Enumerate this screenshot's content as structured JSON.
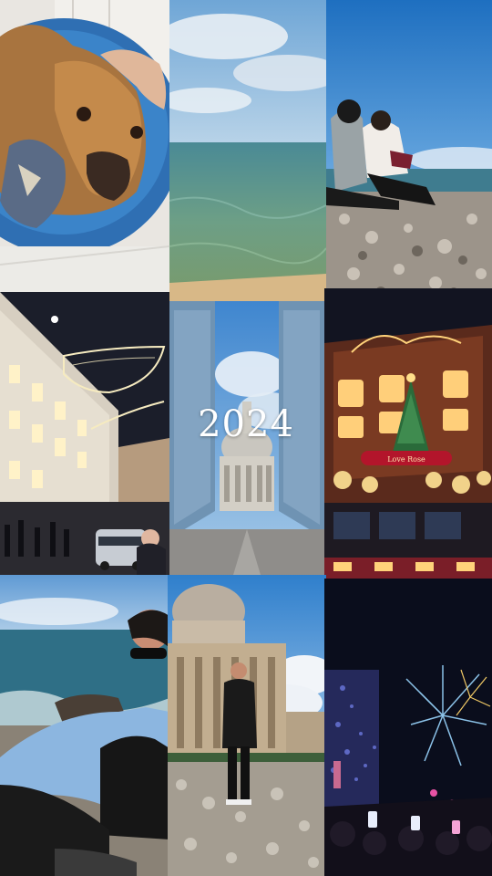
{
  "overlay": {
    "year_title": "2024"
  },
  "sign": {
    "store_text": "Love Rose"
  }
}
